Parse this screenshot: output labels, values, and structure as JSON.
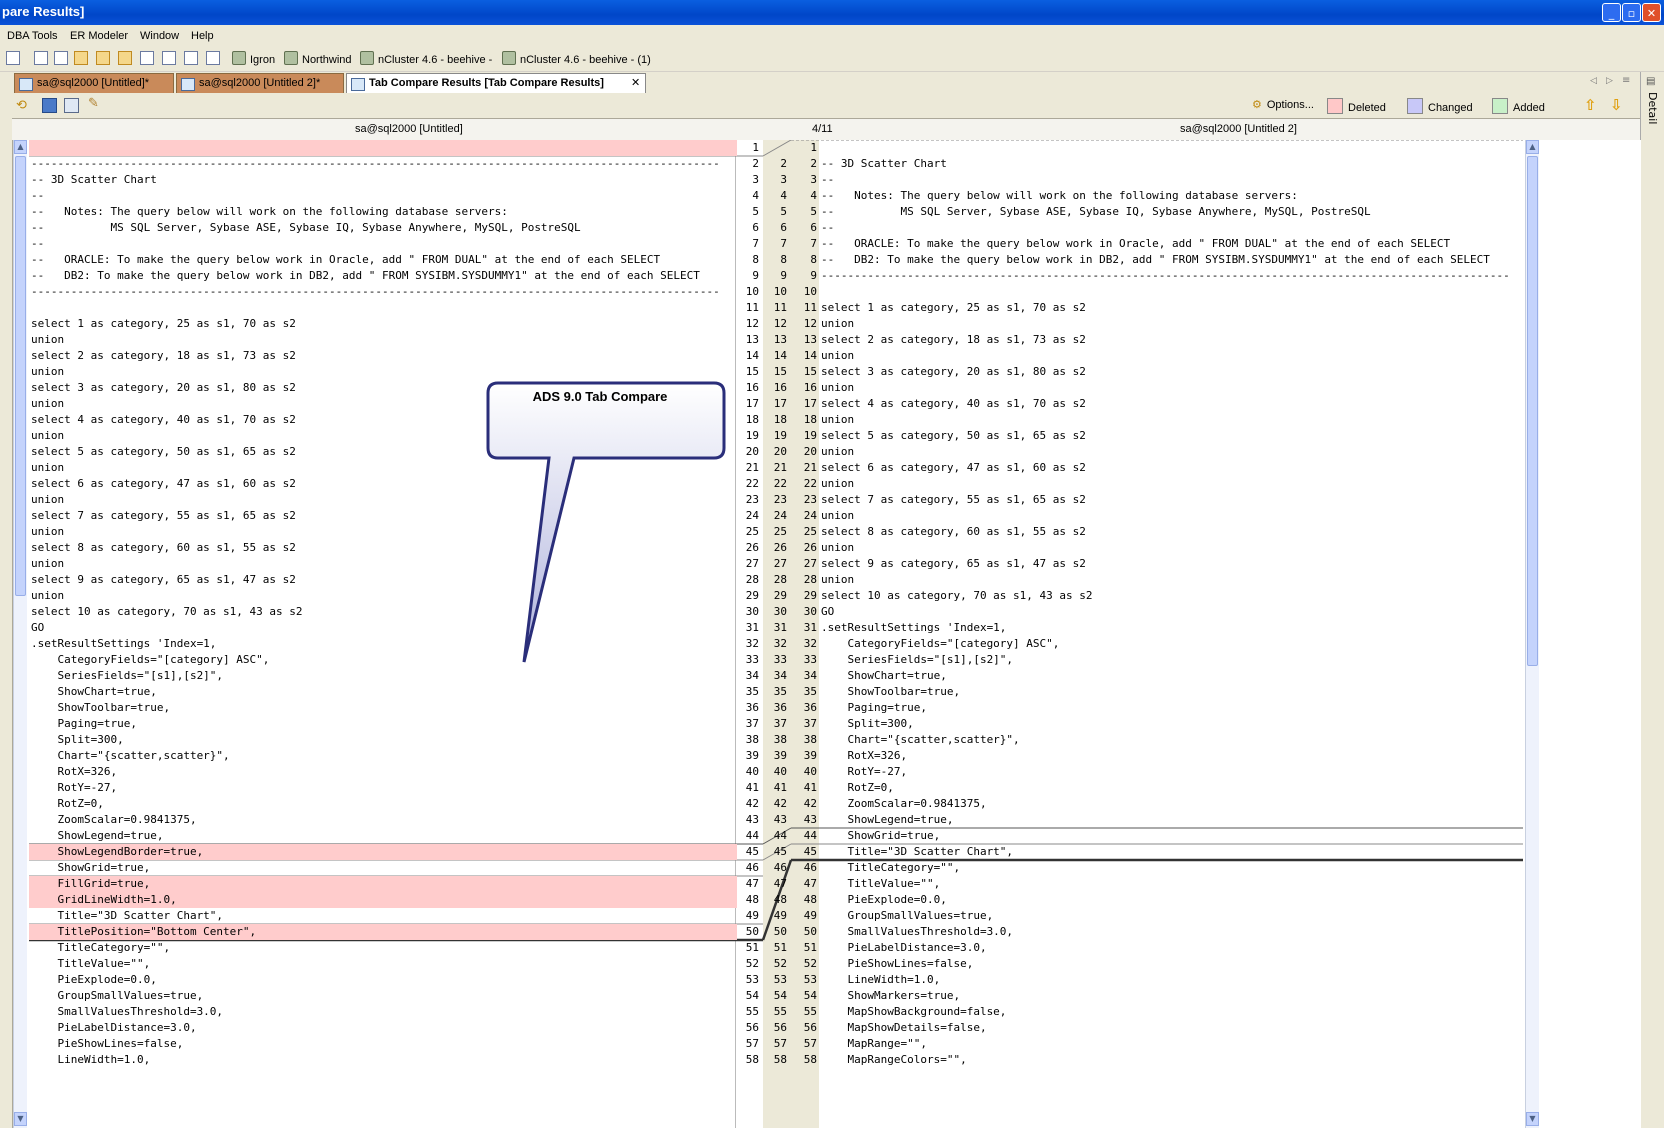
{
  "window": {
    "title": "pare Results]",
    "buttons": [
      "minimize",
      "restore",
      "close"
    ]
  },
  "menu": [
    "DBA Tools",
    "ER Modeler",
    "Window",
    "Help"
  ],
  "toolbar": {
    "connections": [
      "Igron",
      "Northwind",
      "nCluster 4.6 - beehive -",
      "nCluster 4.6 - beehive -  (1)"
    ]
  },
  "tabs": [
    {
      "label": "sa@sql2000 [Untitled]*",
      "active": false
    },
    {
      "label": "sa@sql2000 [Untitled 2]*",
      "active": false
    },
    {
      "label": "Tab Compare Results [Tab Compare Results]",
      "active": true
    }
  ],
  "legend": {
    "options": "Options...",
    "deleted": "Deleted",
    "changed": "Changed",
    "added": "Added",
    "colors": {
      "deleted": "#ffc8c8",
      "changed": "#c8c8f8",
      "added": "#c8f0c8"
    }
  },
  "side_panel": {
    "label": "Detail"
  },
  "compare": {
    "left_title": "sa@sql2000 [Untitled]",
    "right_title": "sa@sql2000 [Untitled 2]",
    "diff_position": "4/11",
    "deleted_color": "#ffcccc",
    "left": [
      "",
      "--------------------------------------------------------------------------------------------------------",
      "-- 3D Scatter Chart",
      "--",
      "--   Notes: The query below will work on the following database servers:",
      "--          MS SQL Server, Sybase ASE, Sybase IQ, Sybase Anywhere, MySQL, PostreSQL",
      "--",
      "--   ORACLE: To make the query below work in Oracle, add \" FROM DUAL\" at the end of each SELECT",
      "--   DB2: To make the query below work in DB2, add \" FROM SYSIBM.SYSDUMMY1\" at the end of each SELECT",
      "--------------------------------------------------------------------------------------------------------",
      "",
      "select 1 as category, 25 as s1, 70 as s2",
      "union",
      "select 2 as category, 18 as s1, 73 as s2",
      "union",
      "select 3 as category, 20 as s1, 80 as s2",
      "union",
      "select 4 as category, 40 as s1, 70 as s2",
      "union",
      "select 5 as category, 50 as s1, 65 as s2",
      "union",
      "select 6 as category, 47 as s1, 60 as s2",
      "union",
      "select 7 as category, 55 as s1, 65 as s2",
      "union",
      "select 8 as category, 60 as s1, 55 as s2",
      "union",
      "select 9 as category, 65 as s1, 47 as s2",
      "union",
      "select 10 as category, 70 as s1, 43 as s2",
      "GO",
      ".setResultSettings 'Index=1,",
      "    CategoryFields=\"[category] ASC\",",
      "    SeriesFields=\"[s1],[s2]\",",
      "    ShowChart=true,",
      "    ShowToolbar=true,",
      "    Paging=true,",
      "    Split=300,",
      "    Chart=\"{scatter,scatter}\",",
      "    RotX=326,",
      "    RotY=-27,",
      "    RotZ=0,",
      "    ZoomScalar=0.9841375,",
      "    ShowLegend=true,",
      "    ShowLegendBorder=true,",
      "    ShowGrid=true,",
      "    FillGrid=true,",
      "    GridLineWidth=1.0,",
      "    Title=\"3D Scatter Chart\",",
      "    TitlePosition=\"Bottom Center\",",
      "    TitleCategory=\"\",",
      "    TitleValue=\"\",",
      "    PieExplode=0.0,",
      "    GroupSmallValues=true,",
      "    SmallValuesThreshold=3.0,",
      "    PieLabelDistance=3.0,",
      "    PieShowLines=false,",
      "    LineWidth=1.0,"
    ],
    "left_numbers": [
      "1",
      "2",
      "3",
      "4",
      "5",
      "6",
      "7",
      "8",
      "9",
      "10",
      "11",
      "12",
      "13",
      "14",
      "15",
      "16",
      "17",
      "18",
      "19",
      "20",
      "21",
      "22",
      "23",
      "24",
      "25",
      "26",
      "27",
      "28",
      "29",
      "30",
      "31",
      "32",
      "33",
      "34",
      "35",
      "36",
      "37",
      "38",
      "39",
      "40",
      "41",
      "42",
      "43",
      "44",
      "45",
      "46",
      "47",
      "48",
      "49",
      "50",
      "51",
      "52",
      "53",
      "54",
      "55",
      "56",
      "57",
      "58"
    ],
    "left_deleted": [
      0,
      44,
      46,
      47,
      49
    ],
    "right": [
      "",
      "-- 3D Scatter Chart",
      "--",
      "--   Notes: The query below will work on the following database servers:",
      "--          MS SQL Server, Sybase ASE, Sybase IQ, Sybase Anywhere, MySQL, PostreSQL",
      "--",
      "--   ORACLE: To make the query below work in Oracle, add \" FROM DUAL\" at the end of each SELECT",
      "--   DB2: To make the query below work in DB2, add \" FROM SYSIBM.SYSDUMMY1\" at the end of each SELECT",
      "--------------------------------------------------------------------------------------------------------",
      "",
      "select 1 as category, 25 as s1, 70 as s2",
      "union",
      "select 2 as category, 18 as s1, 73 as s2",
      "union",
      "select 3 as category, 20 as s1, 80 as s2",
      "union",
      "select 4 as category, 40 as s1, 70 as s2",
      "union",
      "select 5 as category, 50 as s1, 65 as s2",
      "union",
      "select 6 as category, 47 as s1, 60 as s2",
      "union",
      "select 7 as category, 55 as s1, 65 as s2",
      "union",
      "select 8 as category, 60 as s1, 55 as s2",
      "union",
      "select 9 as category, 65 as s1, 47 as s2",
      "union",
      "select 10 as category, 70 as s1, 43 as s2",
      "GO",
      ".setResultSettings 'Index=1,",
      "    CategoryFields=\"[category] ASC\",",
      "    SeriesFields=\"[s1],[s2]\",",
      "    ShowChart=true,",
      "    ShowToolbar=true,",
      "    Paging=true,",
      "    Split=300,",
      "    Chart=\"{scatter,scatter}\",",
      "    RotX=326,",
      "    RotY=-27,",
      "    RotZ=0,",
      "    ZoomScalar=0.9841375,",
      "    ShowLegend=true,",
      "    ShowGrid=true,",
      "    Title=\"3D Scatter Chart\",",
      "    TitleCategory=\"\",",
      "    TitleValue=\"\",",
      "    PieExplode=0.0,",
      "    GroupSmallValues=true,",
      "    SmallValuesThreshold=3.0,",
      "    PieLabelDistance=3.0,",
      "    PieShowLines=false,",
      "    LineWidth=1.0,",
      "    ShowMarkers=true,",
      "    MapShowBackground=false,",
      "    MapShowDetails=false,",
      "    MapRange=\"\",",
      "    MapRangeColors=\"\","
    ],
    "right_numbers_a": [
      "1",
      "2",
      "3",
      "4",
      "5",
      "6",
      "7",
      "8",
      "9",
      "10",
      "11",
      "12",
      "13",
      "14",
      "15",
      "16",
      "17",
      "18",
      "19",
      "20",
      "21",
      "22",
      "23",
      "24",
      "25",
      "26",
      "27",
      "28",
      "29",
      "30",
      "31",
      "32",
      "33",
      "34",
      "35",
      "36",
      "37",
      "38",
      "39",
      "40",
      "41",
      "42",
      "43",
      "44",
      "45",
      "46",
      "47",
      "48",
      "49",
      "50",
      "51",
      "52",
      "53",
      "54",
      "55",
      "56",
      "57",
      "58"
    ],
    "right_numbers_b": [
      "",
      "2",
      "3",
      "4",
      "5",
      "6",
      "7",
      "8",
      "9",
      "10",
      "11",
      "12",
      "13",
      "14",
      "15",
      "16",
      "17",
      "18",
      "19",
      "20",
      "21",
      "22",
      "23",
      "24",
      "25",
      "26",
      "27",
      "28",
      "29",
      "30",
      "31",
      "32",
      "33",
      "34",
      "35",
      "36",
      "37",
      "38",
      "39",
      "40",
      "41",
      "42",
      "43",
      "44",
      "45",
      "46",
      "47",
      "48",
      "49",
      "50",
      "51",
      "52",
      "53",
      "54",
      "55",
      "56",
      "57",
      "58"
    ]
  },
  "callout": {
    "text": "ADS 9.0 Tab Compare"
  }
}
